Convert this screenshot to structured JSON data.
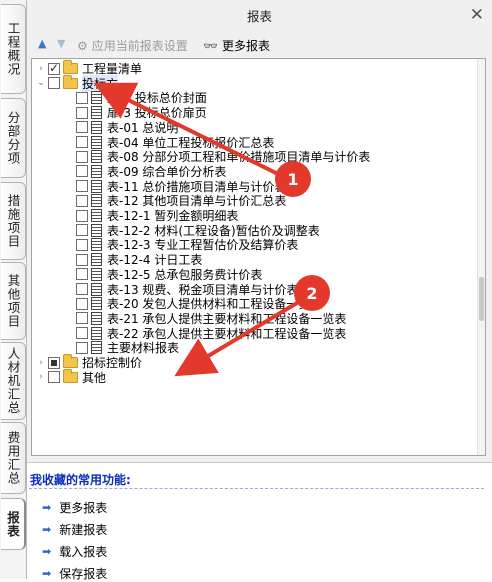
{
  "window": {
    "title": "报表"
  },
  "side_tabs": [
    {
      "label": "工程概况"
    },
    {
      "label": "分部分项"
    },
    {
      "label": "措施项目"
    },
    {
      "label": "其他项目"
    },
    {
      "label": "人材机汇总"
    },
    {
      "label": "费用汇总"
    },
    {
      "label": "报表"
    }
  ],
  "toolbar": {
    "apply_label": "应用当前报表设置",
    "more_label": "更多报表"
  },
  "tree": [
    {
      "label": "工程量清单",
      "level": 0,
      "type": "folder",
      "state": "checked",
      "expander": "collapsed"
    },
    {
      "label": "投标方",
      "level": 0,
      "type": "folder",
      "state": "unchecked",
      "expander": "expanded",
      "selected": true
    },
    {
      "label": "封一 投标总价封面",
      "level": 1,
      "type": "doc",
      "state": "unchecked"
    },
    {
      "label": "扉-3 投标总价扉页",
      "level": 1,
      "type": "doc",
      "state": "unchecked"
    },
    {
      "label": "表-01 总说明",
      "level": 1,
      "type": "doc",
      "state": "unchecked"
    },
    {
      "label": "表-04 单位工程投标报价汇总表",
      "level": 1,
      "type": "doc",
      "state": "unchecked"
    },
    {
      "label": "表-08 分部分项工程和单价措施项目清单与计价表",
      "level": 1,
      "type": "doc",
      "state": "unchecked"
    },
    {
      "label": "表-09 综合单价分析表",
      "level": 1,
      "type": "doc",
      "state": "unchecked"
    },
    {
      "label": "表-11 总价措施项目清单与计价表",
      "level": 1,
      "type": "doc",
      "state": "unchecked"
    },
    {
      "label": "表-12 其他项目清单与计价汇总表",
      "level": 1,
      "type": "doc",
      "state": "unchecked"
    },
    {
      "label": "表-12-1 暂列金额明细表",
      "level": 1,
      "type": "doc",
      "state": "unchecked"
    },
    {
      "label": "表-12-2 材料(工程设备)暂估价及调整表",
      "level": 1,
      "type": "doc",
      "state": "unchecked"
    },
    {
      "label": "表-12-3 专业工程暂估价及结算价表",
      "level": 1,
      "type": "doc",
      "state": "unchecked"
    },
    {
      "label": "表-12-4 计日工表",
      "level": 1,
      "type": "doc",
      "state": "unchecked"
    },
    {
      "label": "表-12-5 总承包服务费计价表",
      "level": 1,
      "type": "doc",
      "state": "unchecked"
    },
    {
      "label": "表-13 规费、税金项目清单与计价表",
      "level": 1,
      "type": "doc",
      "state": "unchecked"
    },
    {
      "label": "表-20 发包人提供材料和工程设备一览表",
      "level": 1,
      "type": "doc",
      "state": "unchecked"
    },
    {
      "label": "表-21 承包人提供主要材料和工程设备一览表",
      "level": 1,
      "type": "doc",
      "state": "unchecked"
    },
    {
      "label": "表-22 承包人提供主要材料和工程设备一览表",
      "level": 1,
      "type": "doc",
      "state": "unchecked"
    },
    {
      "label": "主要材料报表",
      "level": 1,
      "type": "doc",
      "state": "unchecked"
    },
    {
      "label": "招标控制价",
      "level": 0,
      "type": "folder",
      "state": "partial",
      "expander": "collapsed"
    },
    {
      "label": "其他",
      "level": 0,
      "type": "folder",
      "state": "unchecked",
      "expander": "collapsed"
    }
  ],
  "favorites": {
    "title": "我收藏的常用功能:",
    "items": [
      {
        "label": "更多报表"
      },
      {
        "label": "新建报表"
      },
      {
        "label": "载入报表"
      },
      {
        "label": "保存报表"
      }
    ]
  },
  "annotations": [
    {
      "number": "1"
    },
    {
      "number": "2"
    }
  ],
  "colors": {
    "annotation_red": "#e2392c",
    "favorites_title": "#0a2fb8"
  }
}
